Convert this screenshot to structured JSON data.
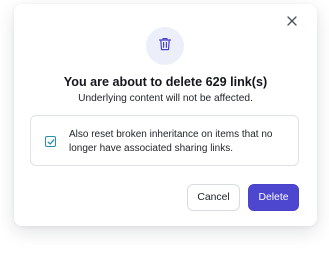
{
  "dialog": {
    "title": "You are about to delete 629 link(s)",
    "subtitle": "Underlying content will not be affected.",
    "option": {
      "checked": true,
      "label": "Also reset broken inheritance on items that no longer have associated sharing links."
    },
    "buttons": {
      "cancel_label": "Cancel",
      "delete_label": "Delete"
    },
    "icons": {
      "header": "trash-icon",
      "close": "close-icon",
      "checkbox": "checkmark-icon"
    },
    "colors": {
      "accent": "#4d46ce",
      "checkbox": "#2a8fa8",
      "icon_bg": "#eceef9"
    }
  }
}
